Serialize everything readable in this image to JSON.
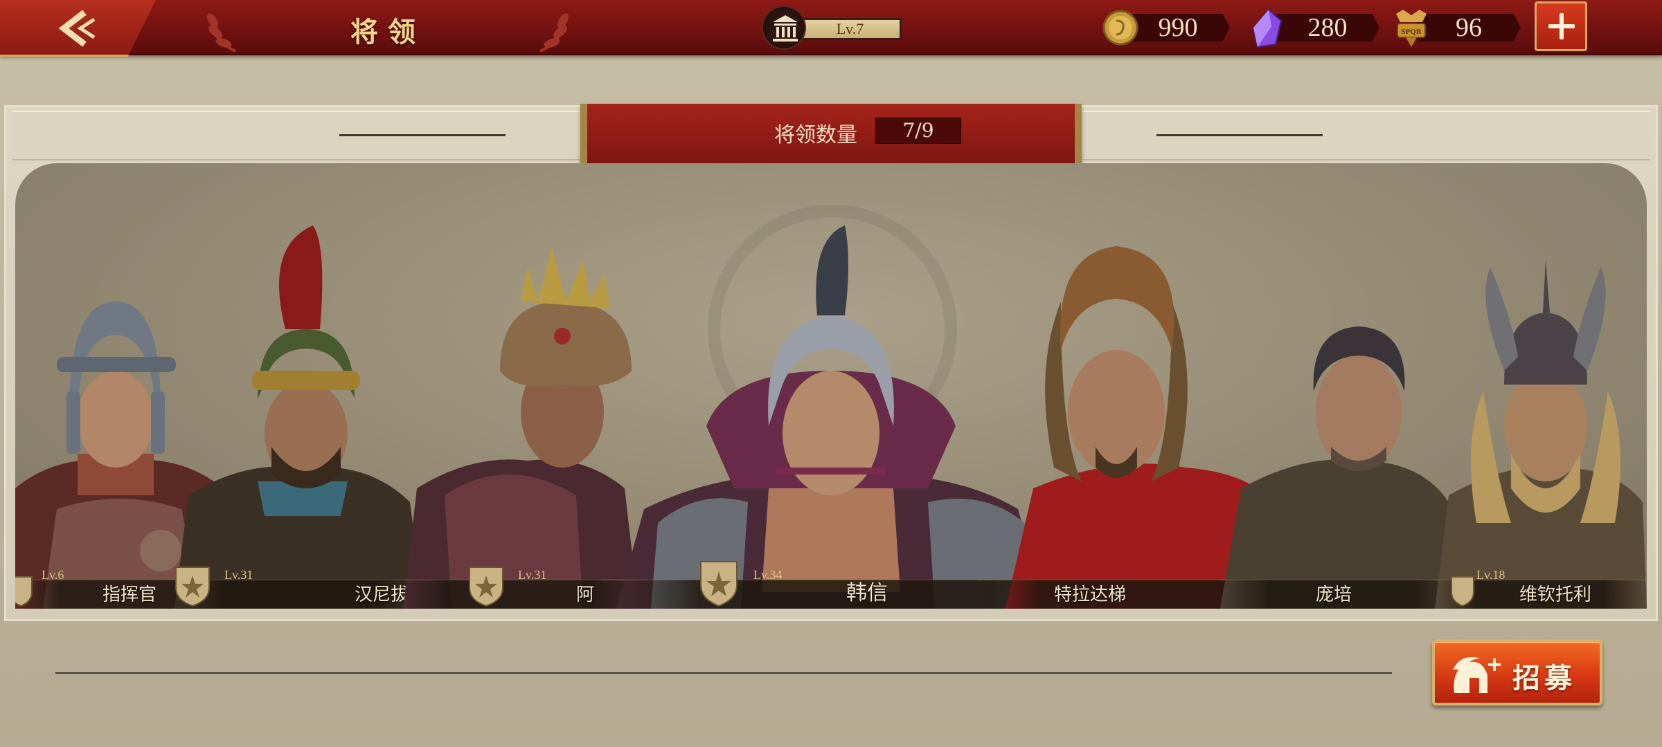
{
  "header": {
    "title": "将领",
    "level_label": "Lv.7"
  },
  "resources": {
    "coins": "990",
    "gems": "280",
    "tokens": "96",
    "token_emblem_text": "SPQR"
  },
  "panel": {
    "count_label": "将领数量",
    "count_value": "7/9"
  },
  "generals": [
    {
      "name": "指挥官",
      "level": "Lv.6"
    },
    {
      "name": "汉尼拔",
      "level": "Lv.31"
    },
    {
      "name": "阿",
      "level": "Lv.31"
    },
    {
      "name": "韩信",
      "level": "Lv.34"
    },
    {
      "name": "特拉达梯",
      "level": ""
    },
    {
      "name": "庞培",
      "level": ""
    },
    {
      "name": "维钦托利",
      "level": "Lv.18"
    }
  ],
  "recruit": {
    "label": "招募"
  },
  "colors": {
    "topbar": "#7a1512",
    "accent_gold": "#f6d58a",
    "button_orange": "#e24a18",
    "panel_bg": "#948a74"
  },
  "icons": [
    "back-arrow-icon",
    "temple-icon",
    "coin-icon",
    "gem-icon",
    "spqr-token-icon",
    "plus-icon",
    "laurel-icon",
    "shield-badge-icon",
    "spartan-helmet-icon"
  ]
}
